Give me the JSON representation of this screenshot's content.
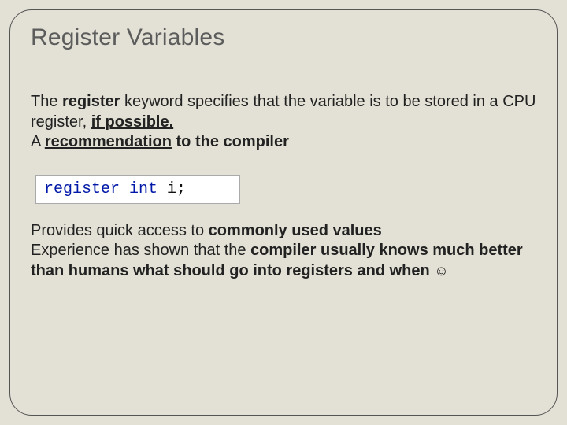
{
  "title": "Register Variables",
  "p1": {
    "t1": "The ",
    "t2": "register",
    "t3": " keyword specifies that the variable is to be stored in a CPU register, ",
    "t4": "if possible.",
    "t5": "A ",
    "t6": "recommendation",
    "t7": " to the compiler"
  },
  "code": {
    "kw1": "register",
    "kw2": "int",
    "rest": " i;"
  },
  "p2": {
    "t1": "Provides quick access to ",
    "t2": "commonly used values",
    "t3": "Experience has shown that the ",
    "t4": "compiler usually knows much better than humans what should go into registers and when",
    "smiley": "☺"
  }
}
